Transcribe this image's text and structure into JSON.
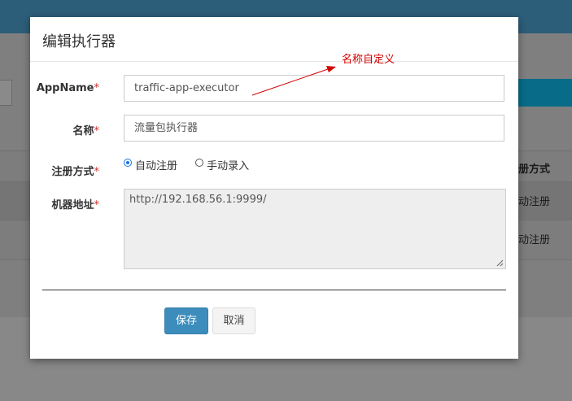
{
  "background": {
    "table_header_col": "册方式",
    "rows": [
      "动注册",
      "动注册"
    ]
  },
  "modal": {
    "title": "编辑执行器",
    "required_mark": "*",
    "fields": {
      "appname": {
        "label": "AppName",
        "value": "traffic-app-executor"
      },
      "name": {
        "label": "名称",
        "value": "流量包执行器"
      },
      "register_type": {
        "label": "注册方式",
        "options": [
          "自动注册",
          "手动录入"
        ],
        "selected": "自动注册"
      },
      "address": {
        "label": "机器地址",
        "value": "http://192.168.56.1:9999/"
      }
    },
    "buttons": {
      "save": "保存",
      "cancel": "取消"
    }
  },
  "annotation": {
    "text": "名称自定义",
    "color": "#d40000"
  },
  "colors": {
    "header": "#2c5d79",
    "primary_button": "#3c8dbc",
    "required": "#c9302c"
  }
}
